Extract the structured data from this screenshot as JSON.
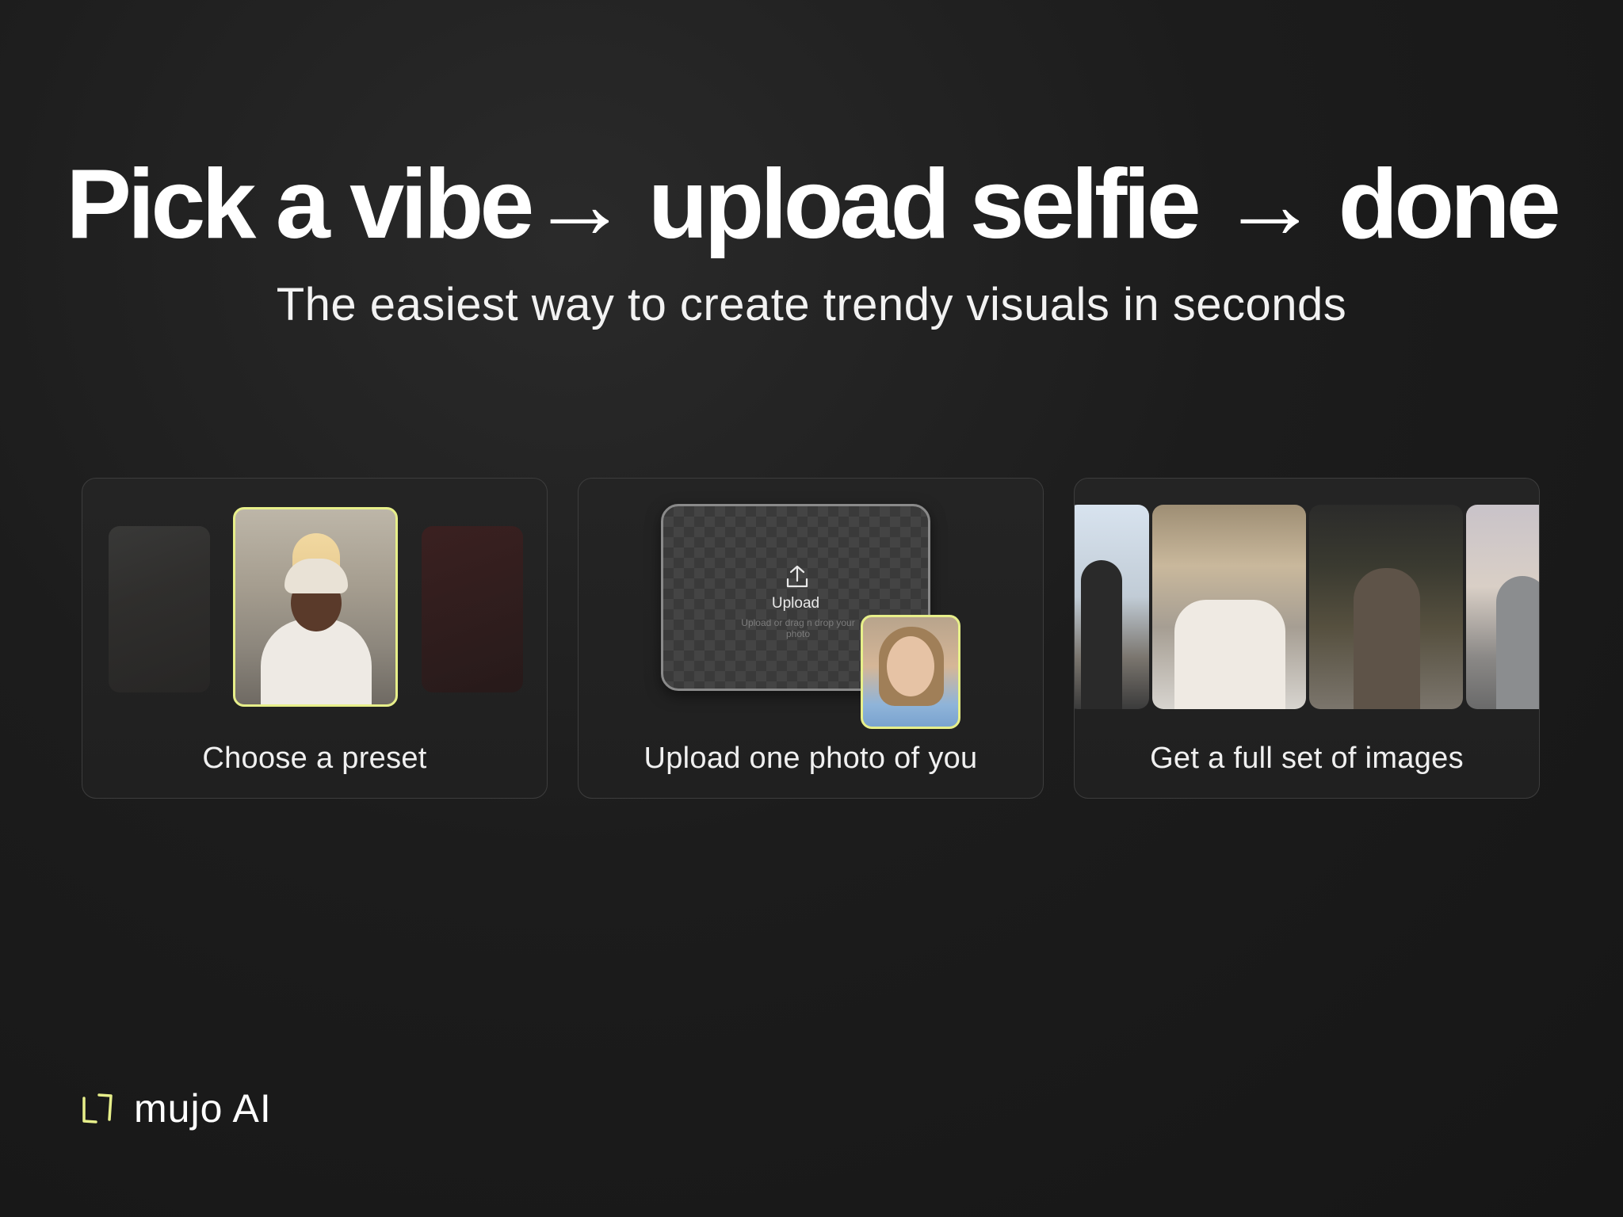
{
  "hero": {
    "headline": "Pick  a vibe→ upload selfie → done",
    "subheadline": "The easiest way to create trendy visuals in seconds"
  },
  "steps": [
    {
      "caption": "Choose a preset"
    },
    {
      "caption": "Upload one photo of you"
    },
    {
      "caption": "Get a full set of images"
    }
  ],
  "upload_widget": {
    "title": "Upload",
    "hint": "Upload or drag n drop your photo"
  },
  "brand": {
    "name": "mujo AI",
    "logo_icon": "tilted-square-logo-icon",
    "accent_color": "#e7ef8a"
  }
}
